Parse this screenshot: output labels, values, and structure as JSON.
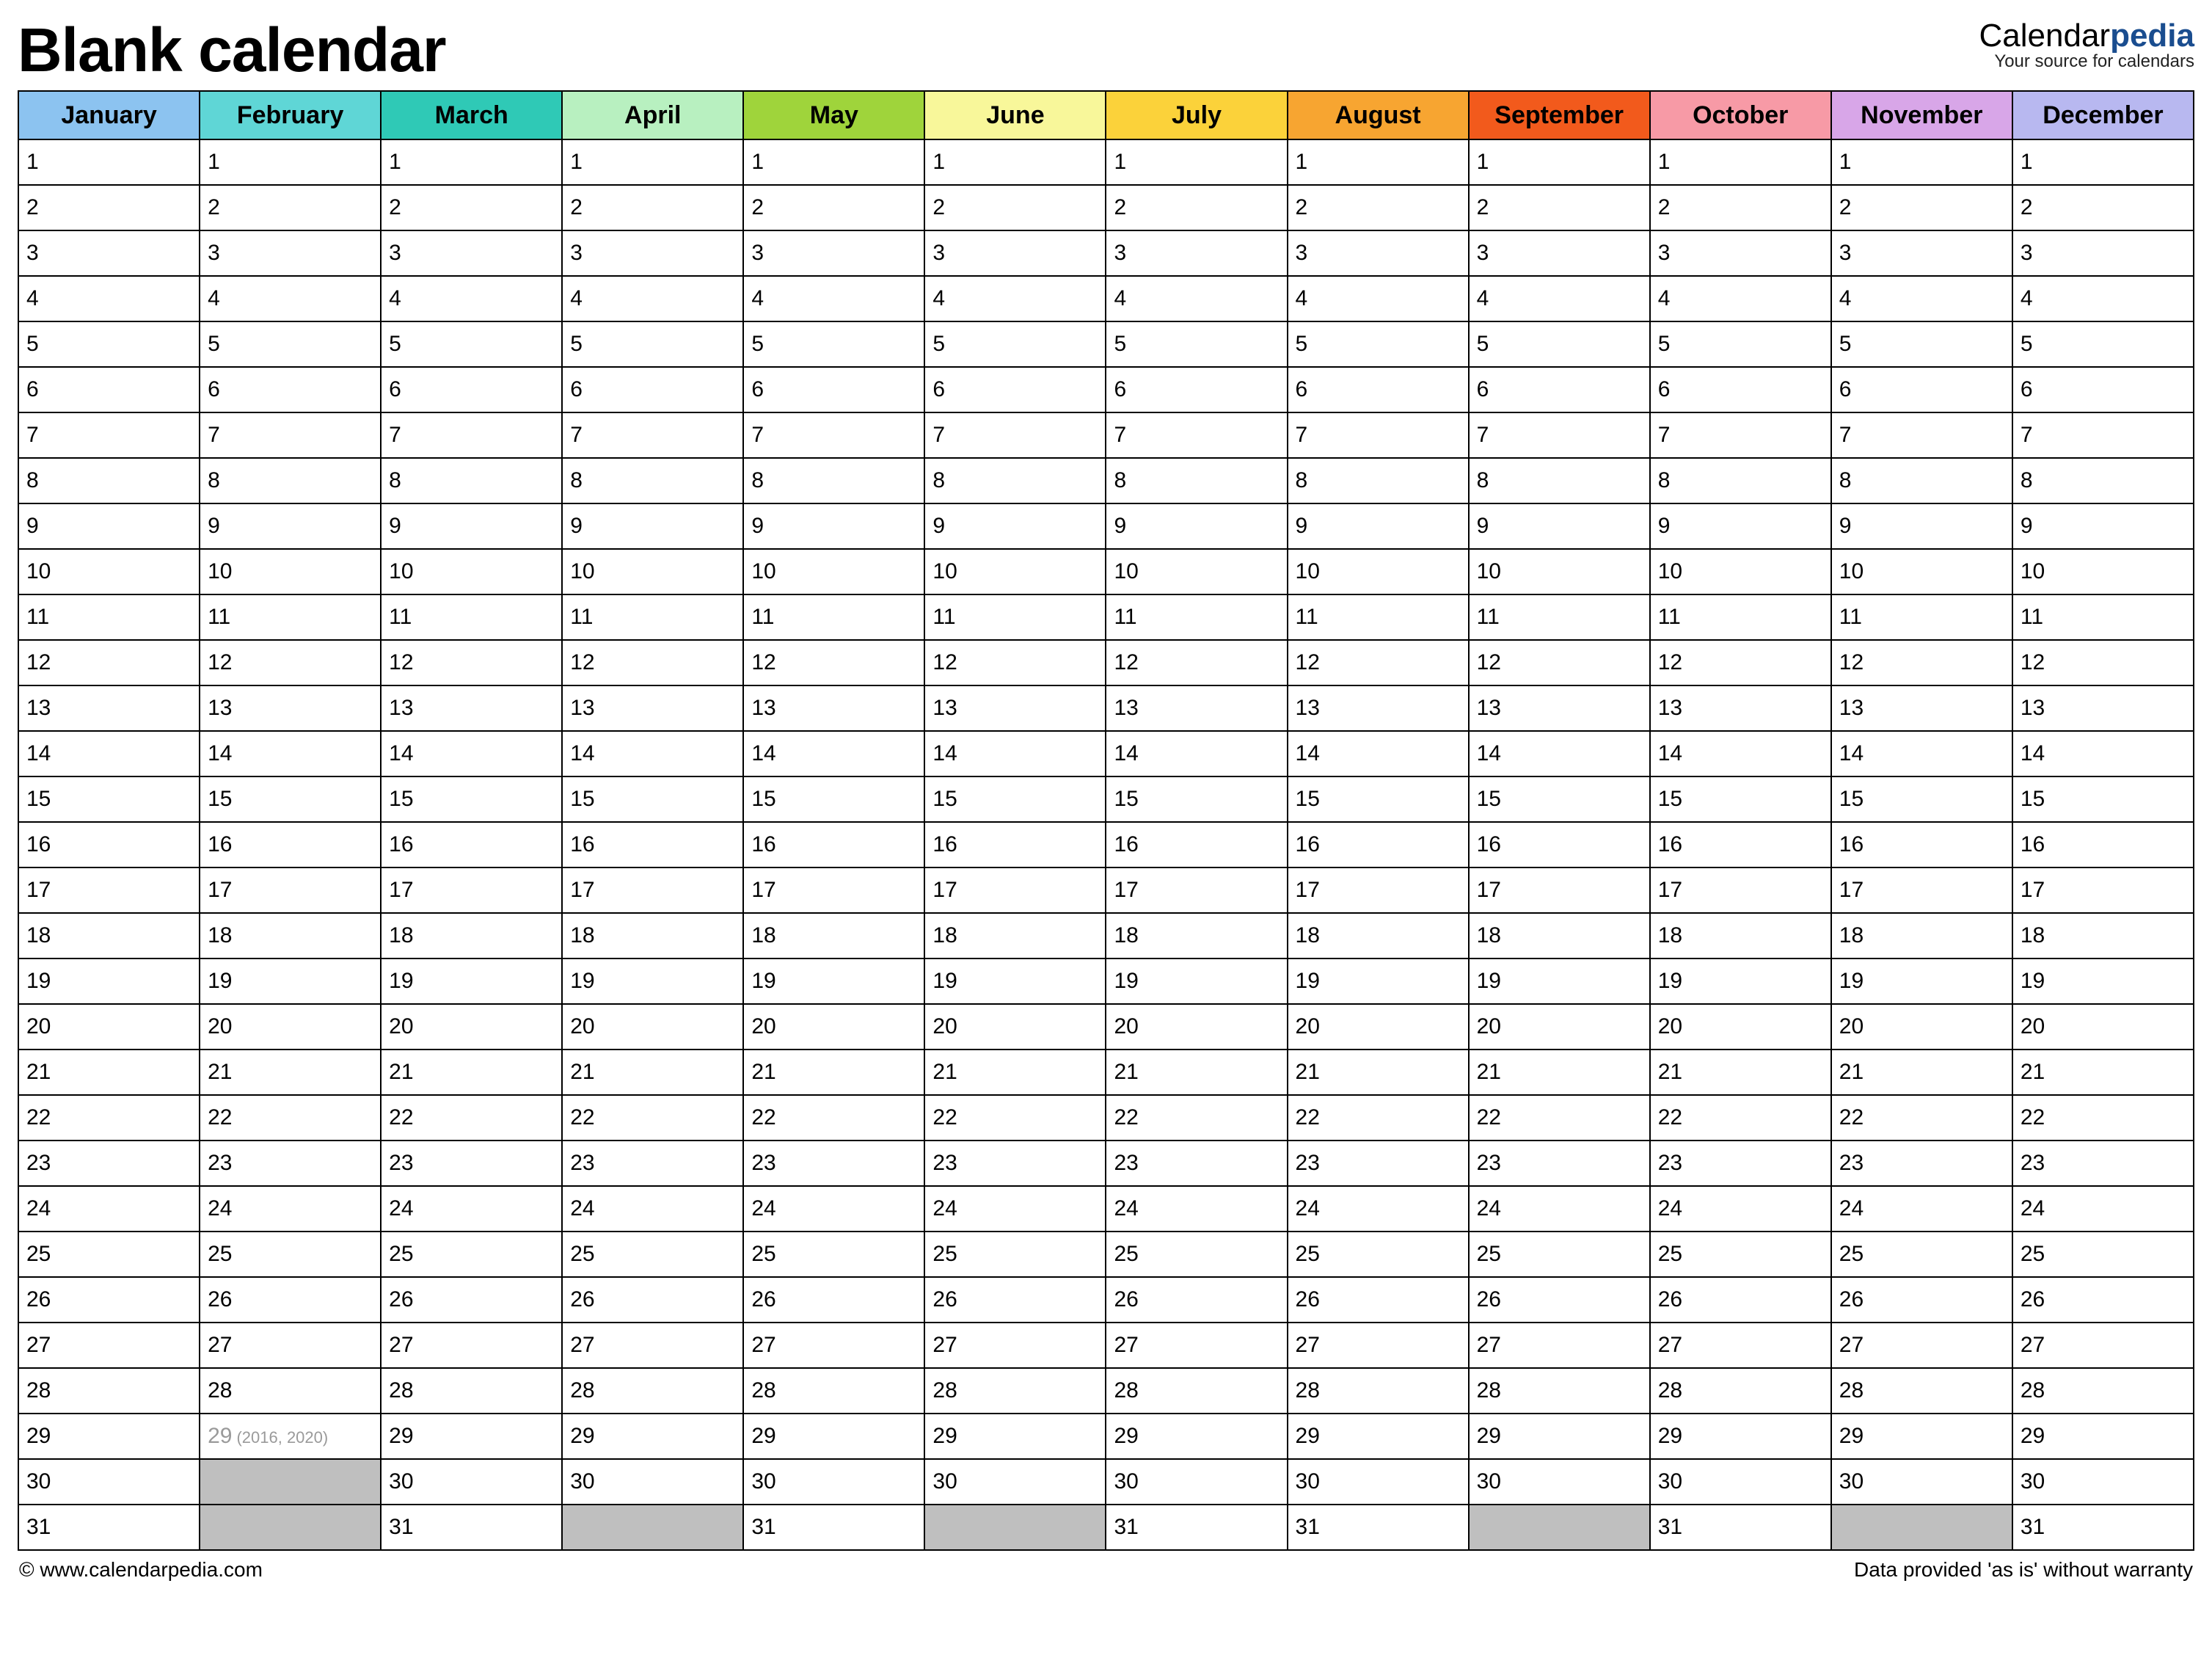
{
  "title": "Blank calendar",
  "brand": {
    "prefix": "Calendar",
    "suffix": "pedia",
    "tagline": "Your source for calendars"
  },
  "footer": {
    "left": "© www.calendarpedia.com",
    "right": "Data provided 'as is' without warranty"
  },
  "months": [
    {
      "name": "January",
      "color": "#8cc3f0",
      "days": 31
    },
    {
      "name": "February",
      "color": "#5fd6d6",
      "days": 29,
      "leap_day": 29,
      "leap_note": "(2016, 2020)"
    },
    {
      "name": "March",
      "color": "#2fc9b6",
      "days": 31
    },
    {
      "name": "April",
      "color": "#b8f0c0",
      "days": 30
    },
    {
      "name": "May",
      "color": "#9fd43b",
      "days": 31
    },
    {
      "name": "June",
      "color": "#f8f79a",
      "days": 30
    },
    {
      "name": "July",
      "color": "#fbd23a",
      "days": 31
    },
    {
      "name": "August",
      "color": "#f7a531",
      "days": 31
    },
    {
      "name": "September",
      "color": "#f25a1c",
      "days": 30
    },
    {
      "name": "October",
      "color": "#f79aa6",
      "days": 31
    },
    {
      "name": "November",
      "color": "#d8a6e8",
      "days": 30
    },
    {
      "name": "December",
      "color": "#b8b8f0",
      "days": 31
    }
  ],
  "max_rows": 31
}
